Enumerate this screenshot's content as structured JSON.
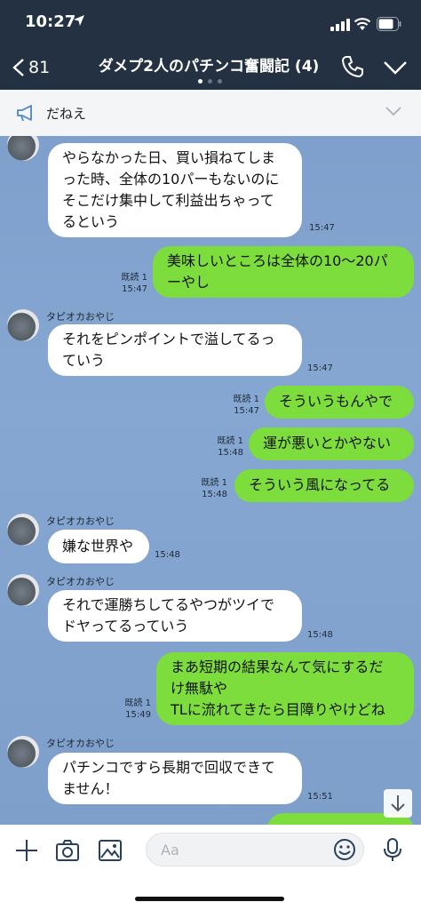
{
  "status": {
    "time": "10:27"
  },
  "header": {
    "back_count": "81",
    "title": "ダメプ2人のパチンコ奮闘記 (4)"
  },
  "announcement": {
    "text": "だねえ"
  },
  "messages": [
    {
      "dir": "in",
      "sender": "タピオカおやじ",
      "lines": [
        "やらなかった日、買い損ねてしま",
        "った時、全体の10パーもないのに",
        "そこだけ集中して利益出ちゃって",
        "るという"
      ],
      "time": "15:47"
    },
    {
      "dir": "out",
      "read": "既読 1",
      "time": "15:47",
      "lines": [
        "美味しいところは全体の10〜20パ",
        "ーやし"
      ]
    },
    {
      "dir": "in",
      "sender": "タピオカおやじ",
      "lines": [
        "それをピンポイントで溢してるっ",
        "ていう"
      ],
      "time": "15:47"
    },
    {
      "dir": "out",
      "read": "既読 1",
      "time": "15:47",
      "lines": [
        "そういうもんやで"
      ]
    },
    {
      "dir": "out",
      "read": "既読 1",
      "time": "15:48",
      "lines": [
        "運が悪いとかやない"
      ]
    },
    {
      "dir": "out",
      "read": "既読 1",
      "time": "15:48",
      "lines": [
        "そういう風になってる"
      ]
    },
    {
      "dir": "in",
      "sender": "タピオカおやじ",
      "lines": [
        "嫌な世界や"
      ],
      "time": "15:48"
    },
    {
      "dir": "in",
      "sender": "タピオカおやじ",
      "lines": [
        "それで運勝ちしてるやつがツイで",
        "ドヤってるっていう"
      ],
      "time": "15:48"
    },
    {
      "dir": "out",
      "read": "既読 1",
      "time": "15:49",
      "lines": [
        "まあ短期の結果なんて気にするだ",
        "け無駄や",
        "TLに流れてきたら目障りやけどね"
      ]
    },
    {
      "dir": "in",
      "sender": "タピオカおやじ",
      "lines": [
        "パチンコですら長期で回収できて",
        "ません！"
      ],
      "time": "15:51"
    }
  ],
  "input": {
    "placeholder": "Aa"
  },
  "colors": {
    "header": "#243142",
    "chat_bg": "#84a4cf",
    "out_bubble": "#7ddd3c",
    "in_bubble": "#ffffff"
  },
  "icons": [
    "location-arrow-icon",
    "signal-icon",
    "wifi-icon",
    "battery-icon",
    "back-chevron-icon",
    "phone-icon",
    "chevron-down-icon",
    "megaphone-icon",
    "arrow-down-icon",
    "plus-icon",
    "camera-icon",
    "image-icon",
    "emoji-icon",
    "microphone-icon"
  ]
}
